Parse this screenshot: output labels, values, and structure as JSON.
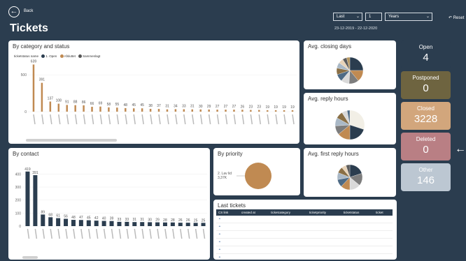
{
  "header": {
    "back_label": "Back",
    "title": "Tickets",
    "filter_mode": "Last",
    "filter_number": "1",
    "filter_unit": "Years",
    "date_range": "23-12-2019 - 22-12-2020",
    "reset_label": "Reset"
  },
  "category_chart": {
    "title": "By category and status",
    "legend_title": "ticketstatus name",
    "legend": [
      "1. Open",
      "Afsluttet",
      "Sammenlagt"
    ],
    "colors": [
      "#2b3d4f",
      "#c08a52",
      "#555555"
    ]
  },
  "contact_chart": {
    "title": "By contact"
  },
  "priority_chart": {
    "title": "By priority",
    "label": "2. Lav lid",
    "value": "3,37K"
  },
  "closing": {
    "title": "Avg. closing days"
  },
  "reply": {
    "title": "Avg. reply hours"
  },
  "first_reply": {
    "title": "Avg. first reply hours"
  },
  "stats": [
    {
      "label": "Open",
      "value": "4",
      "bg": "#2b3d4f",
      "fg": "#ffffff"
    },
    {
      "label": "Postponed",
      "value": "0",
      "bg": "#6e6440",
      "fg": "#ffffff"
    },
    {
      "label": "Closed",
      "value": "3228",
      "bg": "#d2a67c",
      "fg": "#ffffff"
    },
    {
      "label": "Deleted",
      "value": "0",
      "bg": "#b97f84",
      "fg": "#ffffff"
    },
    {
      "label": "Other",
      "value": "146",
      "bg": "#bcc7d2",
      "fg": "#ffffff"
    }
  ],
  "last_tickets": {
    "title": "Last tickets",
    "columns": [
      "CS link",
      "created at",
      "ticketcategory",
      "ticketpriority",
      "ticketstatus",
      "ticket"
    ]
  },
  "chart_data": [
    {
      "type": "bar",
      "title": "By category and status",
      "ylim": [
        0,
        700
      ],
      "yticks": [
        0,
        500
      ],
      "values": [
        639,
        391,
        137,
        108,
        91,
        88,
        86,
        66,
        69,
        58,
        55,
        48,
        45,
        45,
        38,
        37,
        31,
        34,
        33,
        31,
        30,
        29,
        27,
        27,
        27,
        26,
        23,
        23,
        19,
        19,
        19,
        19
      ]
    },
    {
      "type": "bar",
      "title": "By contact",
      "ylim": [
        0,
        450
      ],
      "yticks": [
        0,
        100,
        200,
        300,
        400
      ],
      "values": [
        419,
        391,
        89,
        68,
        61,
        56,
        48,
        47,
        45,
        42,
        40,
        39,
        33,
        33,
        31,
        31,
        30,
        29,
        28,
        28,
        26,
        26,
        25,
        25
      ]
    },
    {
      "type": "pie",
      "title": "By priority",
      "labels": [
        "2. Lav lid"
      ],
      "values": [
        3370
      ]
    }
  ]
}
